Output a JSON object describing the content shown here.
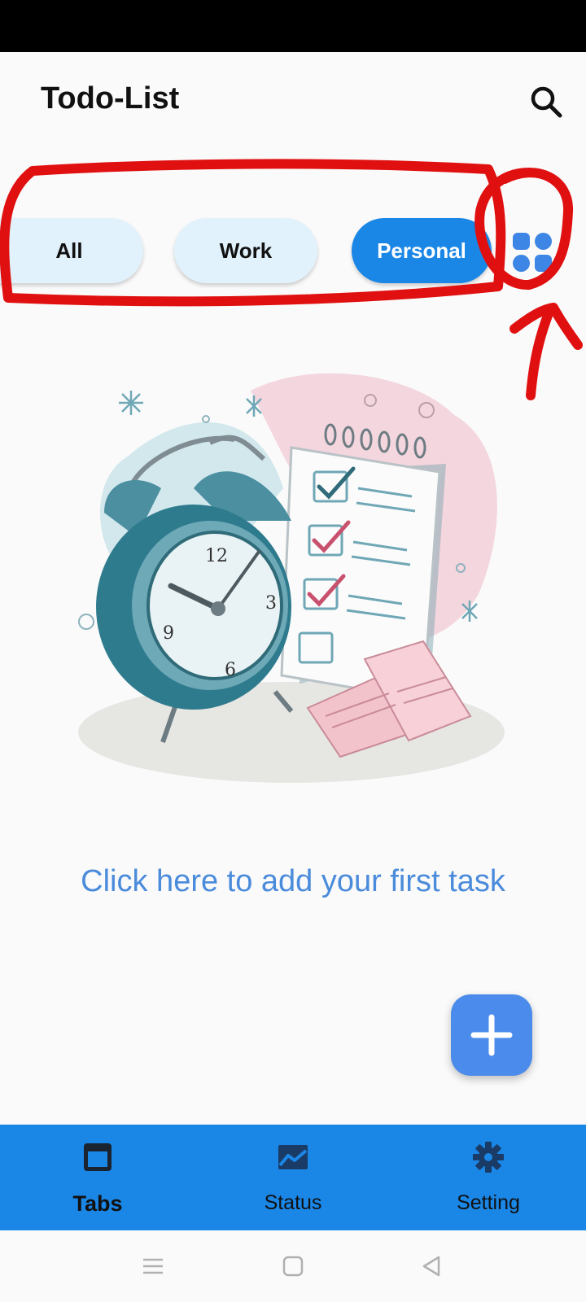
{
  "header": {
    "title": "Todo-List",
    "search_icon": "search-icon"
  },
  "filters": {
    "chips": [
      {
        "label": "All",
        "selected": false
      },
      {
        "label": "Work",
        "selected": false
      },
      {
        "label": "Personal",
        "selected": true
      }
    ],
    "grid_icon": "grid-icon"
  },
  "empty_state": {
    "prompt": "Click here to add your first task"
  },
  "fab": {
    "icon": "plus-icon"
  },
  "bottom_nav": {
    "items": [
      {
        "label": "Tabs",
        "icon": "tab-window-icon",
        "active": true
      },
      {
        "label": "Status",
        "icon": "chart-icon",
        "active": false
      },
      {
        "label": "Setting",
        "icon": "gear-icon",
        "active": false
      }
    ]
  },
  "system_nav": [
    "menu-icon",
    "home-icon",
    "back-icon"
  ],
  "colors": {
    "accent": "#1a86e6",
    "chip_bg": "#e1f2fc",
    "fab": "#4a8beb",
    "prompt_text": "#4a8bdb",
    "annotation": "#e01010"
  }
}
